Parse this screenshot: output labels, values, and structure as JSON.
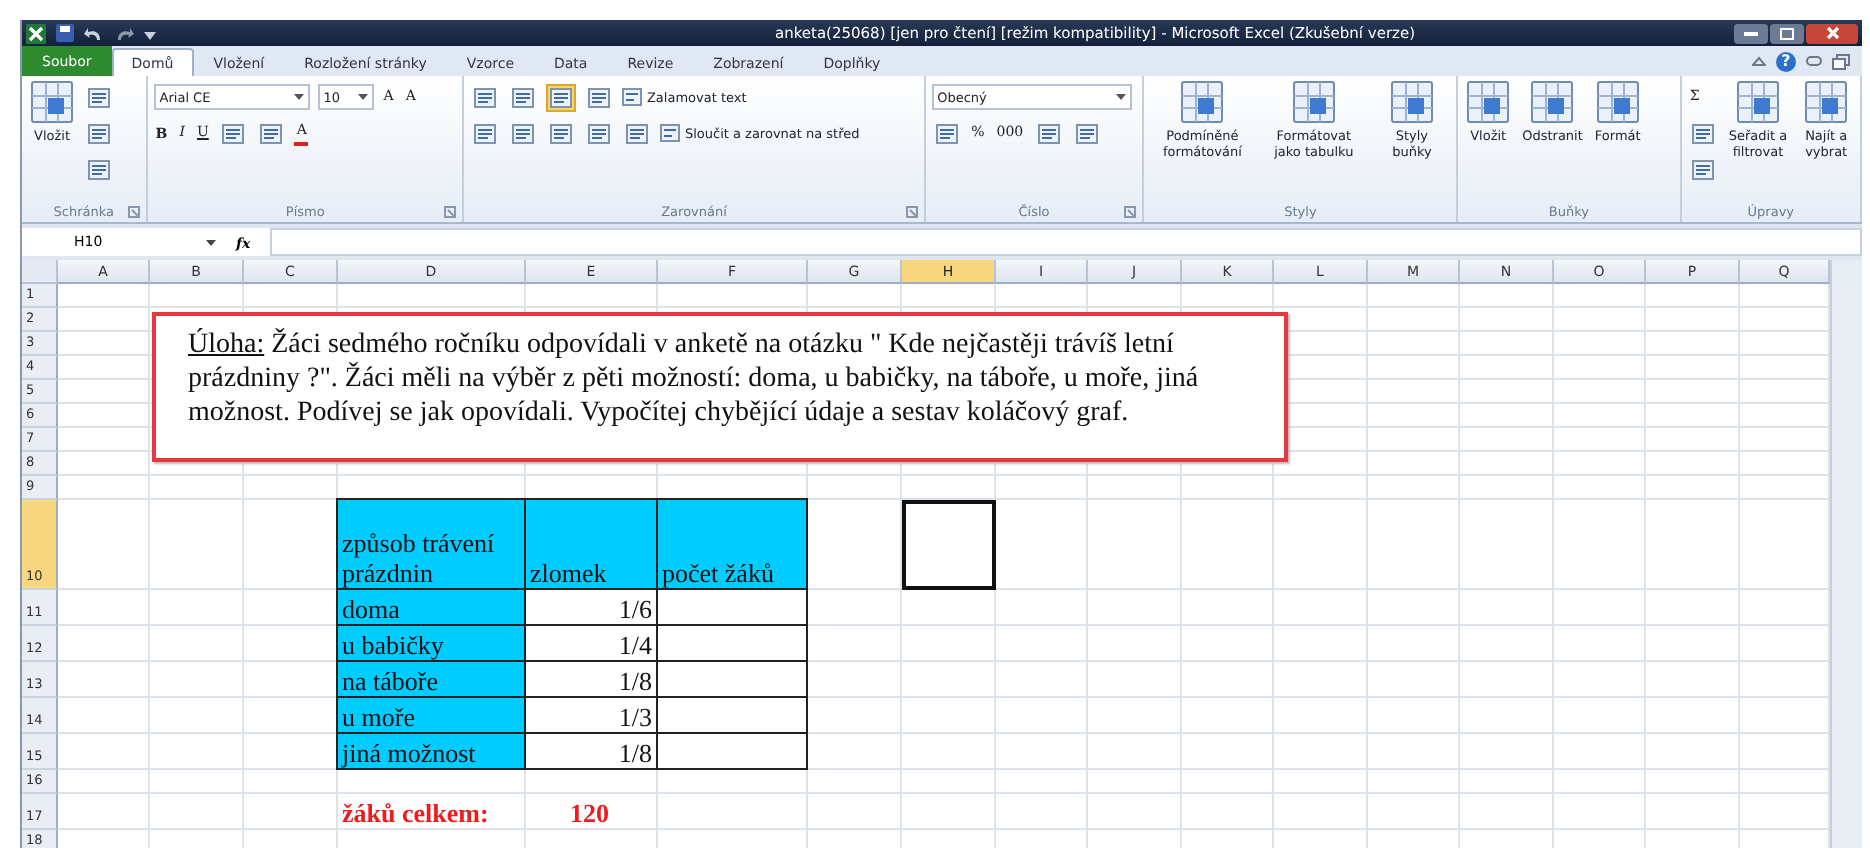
{
  "window": {
    "title": "anketa(25068)  [jen pro čtení]  [režim kompatibility]  -  Microsoft Excel (Zkušební verze)"
  },
  "tabs": [
    {
      "label": "Soubor",
      "kind": "file",
      "selected": false
    },
    {
      "label": "Domů",
      "kind": "tab",
      "selected": true
    },
    {
      "label": "Vložení",
      "kind": "tab",
      "selected": false
    },
    {
      "label": "Rozložení stránky",
      "kind": "tab",
      "selected": false
    },
    {
      "label": "Vzorce",
      "kind": "tab",
      "selected": false
    },
    {
      "label": "Data",
      "kind": "tab",
      "selected": false
    },
    {
      "label": "Revize",
      "kind": "tab",
      "selected": false
    },
    {
      "label": "Zobrazení",
      "kind": "tab",
      "selected": false
    },
    {
      "label": "Doplňky",
      "kind": "tab",
      "selected": false
    }
  ],
  "help_label": "?",
  "ribbon": [
    {
      "name": "Schránka",
      "launcher": true,
      "items": [
        {
          "kind": "large",
          "label": "Vložit"
        },
        {
          "kind": "stack",
          "lines": [
            {
              "items": [
                {
                  "kind": "icon"
                }
              ]
            },
            {
              "items": [
                {
                  "kind": "icon"
                }
              ]
            },
            {
              "items": [
                {
                  "kind": "icon"
                }
              ]
            }
          ]
        }
      ]
    },
    {
      "name": "Písmo",
      "launcher": true,
      "items": [
        {
          "kind": "stack",
          "lines": [
            {
              "items": [
                {
                  "kind": "field",
                  "value": "Arial CE",
                  "wide": true
                },
                {
                  "kind": "field",
                  "value": "10",
                  "wide": false
                },
                {
                  "kind": "text",
                  "text": "A"
                },
                {
                  "kind": "text",
                  "text": "A"
                }
              ]
            },
            {
              "items": [
                {
                  "kind": "bold",
                  "text": "B"
                },
                {
                  "kind": "italic",
                  "text": "I"
                },
                {
                  "kind": "underline",
                  "text": "U"
                },
                {
                  "kind": "icon"
                },
                {
                  "kind": "icon"
                },
                {
                  "kind": "text",
                  "text": "A",
                  "color": "#e0201a"
                }
              ]
            }
          ]
        }
      ]
    },
    {
      "name": "Zarovnání",
      "launcher": true,
      "items": [
        {
          "kind": "stack",
          "lines": [
            {
              "items": [
                {
                  "kind": "icon",
                  "selected": false
                },
                {
                  "kind": "icon",
                  "selected": false
                },
                {
                  "kind": "icon",
                  "selected": true
                },
                {
                  "kind": "icon",
                  "selected": false
                },
                {
                  "kind": "labeled",
                  "label": "Zalamovat text"
                }
              ]
            },
            {
              "items": [
                {
                  "kind": "icon",
                  "selected": false
                },
                {
                  "kind": "icon",
                  "selected": false
                },
                {
                  "kind": "icon",
                  "selected": false
                },
                {
                  "kind": "icon",
                  "selected": false
                },
                {
                  "kind": "icon",
                  "selected": false
                },
                {
                  "kind": "labeled",
                  "label": "Sloučit a zarovnat na střed"
                }
              ]
            }
          ]
        }
      ]
    },
    {
      "name": "Číslo",
      "launcher": true,
      "items": [
        {
          "kind": "stack",
          "lines": [
            {
              "items": [
                {
                  "kind": "field",
                  "value": "Obecný",
                  "wide": true
                }
              ]
            },
            {
              "items": [
                {
                  "kind": "icon"
                },
                {
                  "kind": "text",
                  "text": "%"
                },
                {
                  "kind": "text",
                  "text": "000"
                },
                {
                  "kind": "icon"
                },
                {
                  "kind": "icon"
                }
              ]
            }
          ]
        }
      ]
    },
    {
      "name": "Styly",
      "launcher": false,
      "items": [
        {
          "kind": "large",
          "label": "Podmíněné formátování"
        },
        {
          "kind": "large",
          "label": "Formátovat jako tabulku"
        },
        {
          "kind": "large",
          "label": "Styly buňky"
        }
      ]
    },
    {
      "name": "Buňky",
      "launcher": false,
      "items": [
        {
          "kind": "large",
          "label": "Vložit"
        },
        {
          "kind": "large",
          "label": "Odstranit"
        },
        {
          "kind": "large",
          "label": "Formát"
        }
      ]
    },
    {
      "name": "Úpravy",
      "launcher": false,
      "items": [
        {
          "kind": "stack",
          "lines": [
            {
              "items": [
                {
                  "kind": "text",
                  "text": "Σ"
                }
              ]
            },
            {
              "items": [
                {
                  "kind": "icon"
                }
              ]
            },
            {
              "items": [
                {
                  "kind": "icon"
                }
              ]
            }
          ]
        },
        {
          "kind": "large",
          "label": "Seřadit a filtrovat"
        },
        {
          "kind": "large",
          "label": "Najít a vybrat"
        }
      ]
    }
  ],
  "formula_bar": {
    "name_box": "H10",
    "function_label": "fx"
  },
  "sheet": {
    "columns": [
      {
        "label": "A",
        "selected": false
      },
      {
        "label": "B",
        "selected": false
      },
      {
        "label": "C",
        "selected": false
      },
      {
        "label": "D",
        "selected": false
      },
      {
        "label": "E",
        "selected": false
      },
      {
        "label": "F",
        "selected": false
      },
      {
        "label": "G",
        "selected": false
      },
      {
        "label": "H",
        "selected": true
      },
      {
        "label": "I",
        "selected": false
      },
      {
        "label": "J",
        "selected": false
      },
      {
        "label": "K",
        "selected": false
      },
      {
        "label": "L",
        "selected": false
      },
      {
        "label": "M",
        "selected": false
      },
      {
        "label": "N",
        "selected": false
      },
      {
        "label": "O",
        "selected": false
      },
      {
        "label": "P",
        "selected": false
      },
      {
        "label": "Q",
        "selected": false
      }
    ],
    "rows": [
      {
        "label": "1",
        "selected": false
      },
      {
        "label": "2",
        "selected": false
      },
      {
        "label": "3",
        "selected": false
      },
      {
        "label": "4",
        "selected": false
      },
      {
        "label": "5",
        "selected": false
      },
      {
        "label": "6",
        "selected": false
      },
      {
        "label": "7",
        "selected": false
      },
      {
        "label": "8",
        "selected": false
      },
      {
        "label": "9",
        "selected": false
      },
      {
        "label": "10",
        "selected": true
      },
      {
        "label": "11",
        "selected": false
      },
      {
        "label": "12",
        "selected": false
      },
      {
        "label": "13",
        "selected": false
      },
      {
        "label": "14",
        "selected": false
      },
      {
        "label": "15",
        "selected": false
      },
      {
        "label": "16",
        "selected": false
      },
      {
        "label": "17",
        "selected": false
      },
      {
        "label": "18",
        "selected": false
      }
    ],
    "text_box": {
      "label": "Úloha:",
      "text": " Žáci sedmého ročníku odpovídali v anketě na otázku \" Kde nejčastěji trávíš letní prázdniny ?\". Žáci měli na výběr z pěti možností: doma, u babičky, na táboře, u moře, jiná možnost. Podívej se jak opovídali. Vypočítej chybějící údaje a sestav koláčový graf."
    },
    "table": {
      "header": [
        "způsob trávení prázdnin",
        "zlomek",
        "počet žáků"
      ],
      "rows": [
        {
          "label": "doma",
          "fraction": "1/6"
        },
        {
          "label": "u babičky",
          "fraction": "1/4"
        },
        {
          "label": "na táboře",
          "fraction": "1/8"
        },
        {
          "label": "u moře",
          "fraction": "1/3"
        },
        {
          "label": "jiná možnost",
          "fraction": "1/8"
        }
      ]
    },
    "total": {
      "label": "žáků celkem:",
      "value": "120"
    }
  }
}
